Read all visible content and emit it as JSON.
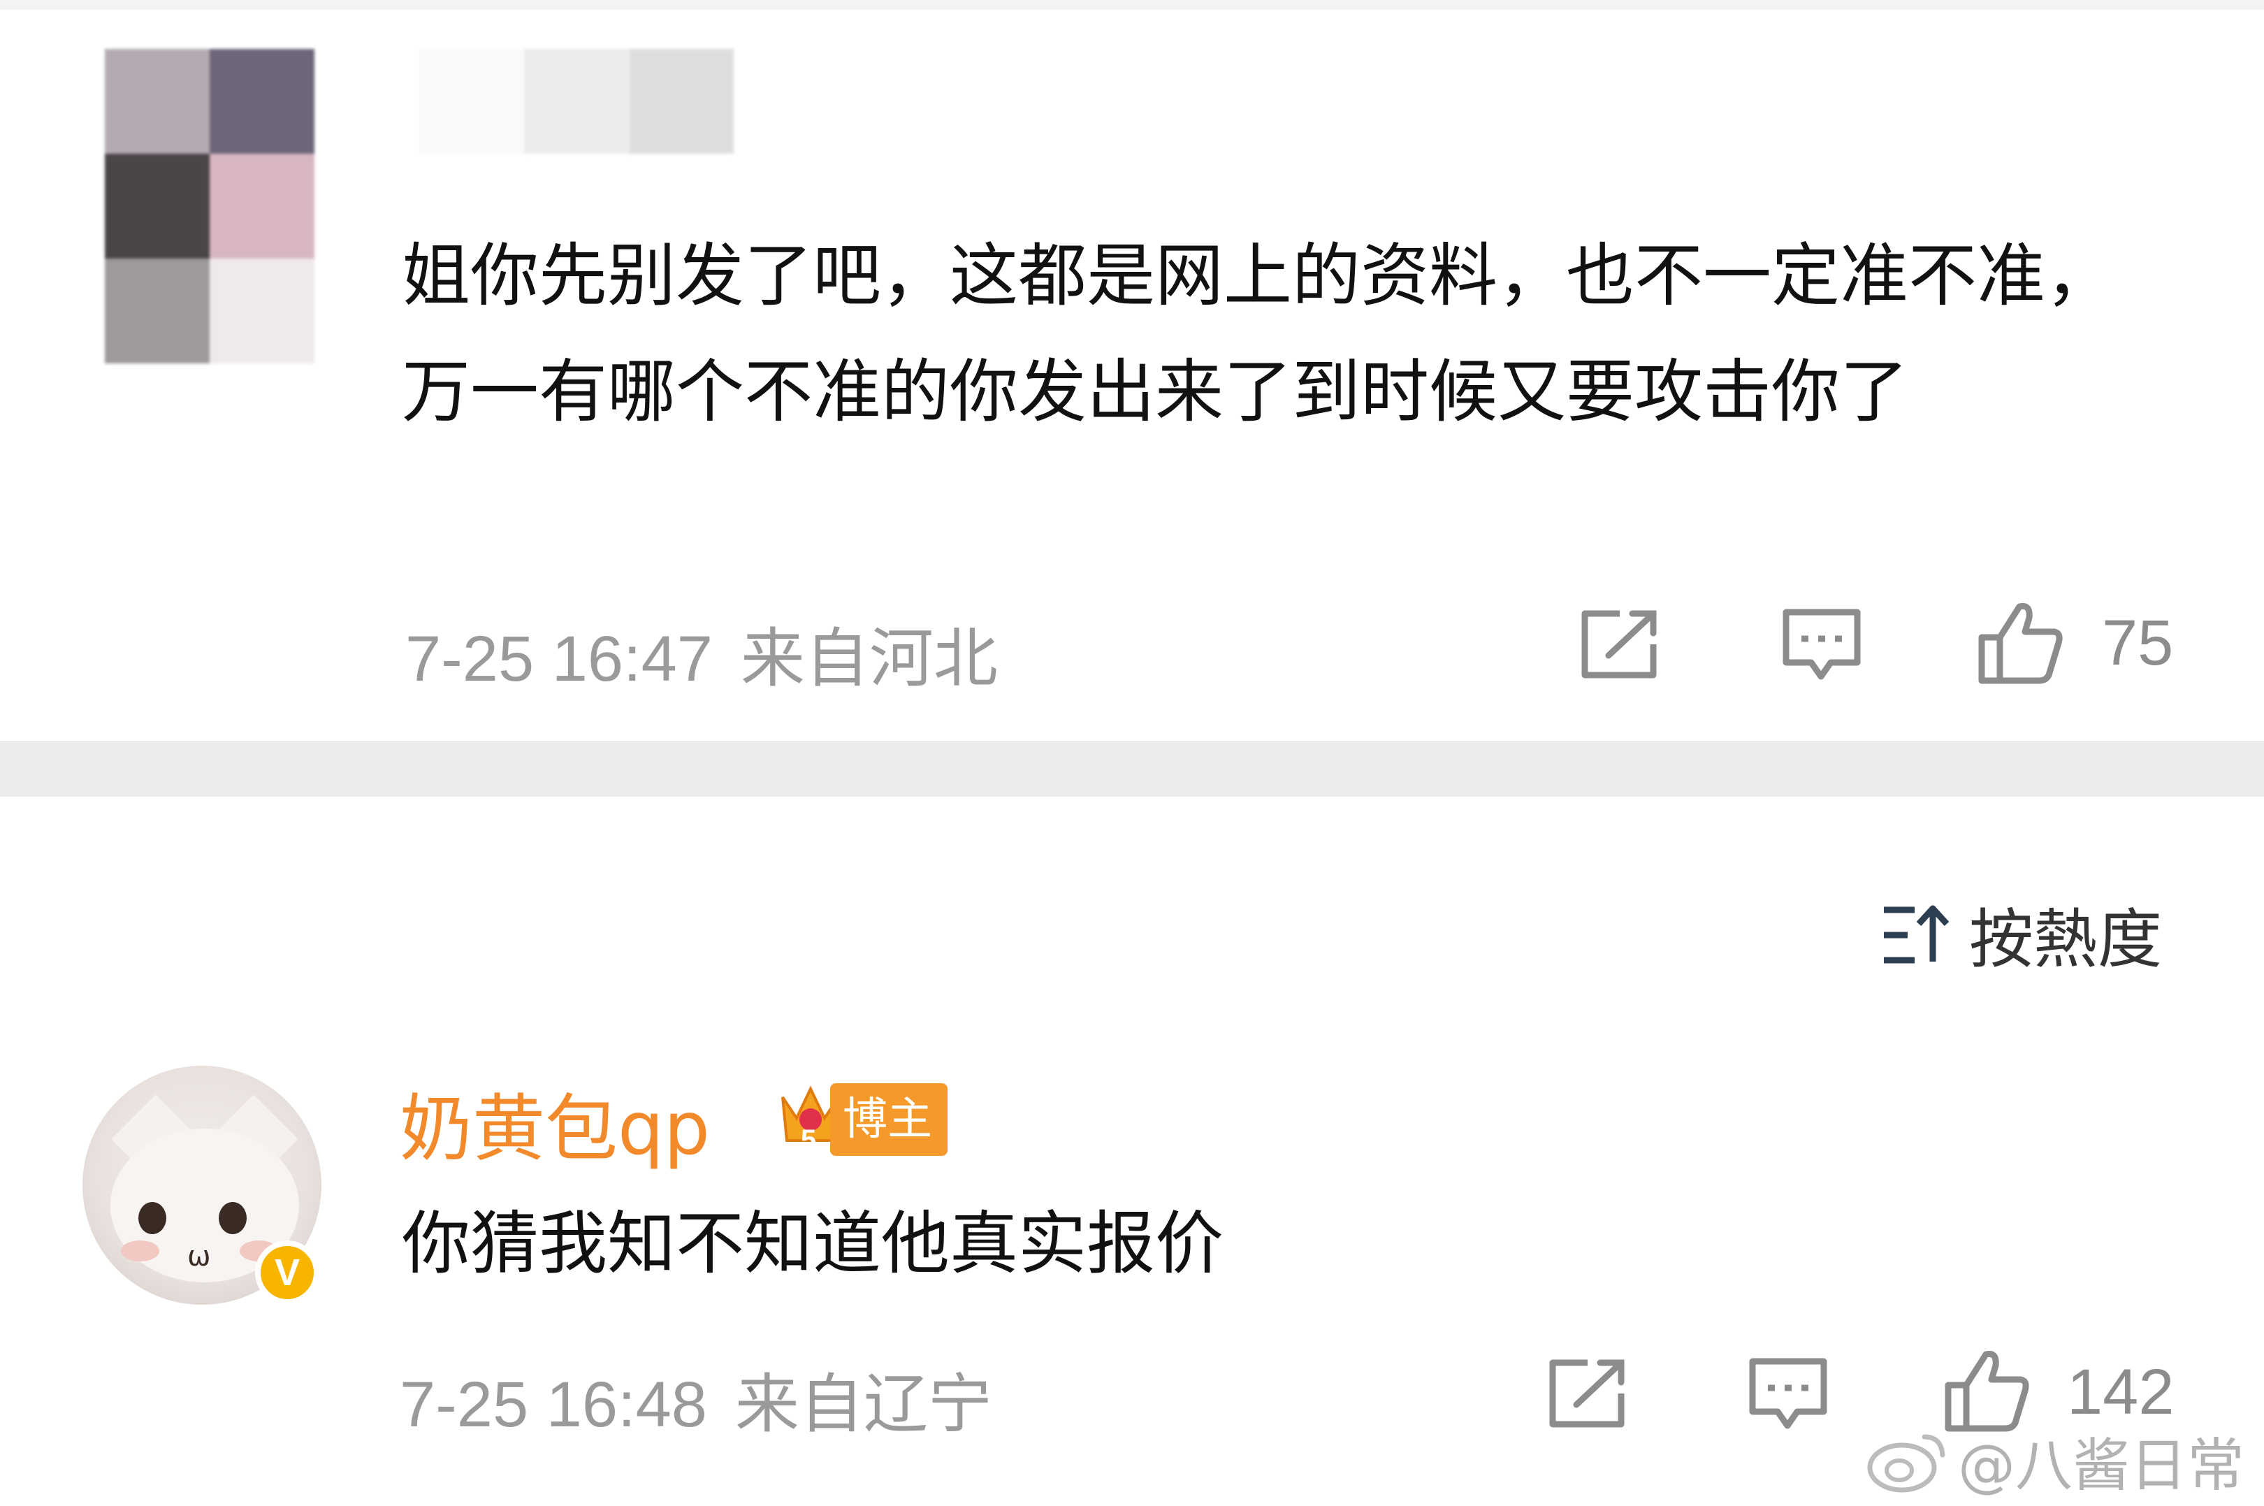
{
  "comment1": {
    "text": "姐你先别发了吧，这都是网上的资料，也不一定准不准，万一有哪个不准的你发出来了到时候又要攻击你了",
    "date": "7-25 16:47",
    "location": "来自河北",
    "like_count": "75",
    "icons": [
      "share-icon",
      "comment-icon",
      "like-icon"
    ]
  },
  "sort": {
    "label": "按熱度",
    "icon": "sort-icon"
  },
  "comment2": {
    "username": "奶黄包qp",
    "badge_label": "博主",
    "badge_level": "5",
    "verified_mark": "V",
    "text": "你猜我知不知道他真实报价",
    "date": "7-25 16:48",
    "location": "来自辽宁",
    "like_count": "142",
    "icons": [
      "share-icon",
      "comment-icon",
      "like-icon"
    ]
  },
  "watermark": {
    "text": "@八酱日常",
    "icon": "weibo-logo-icon"
  },
  "colors": {
    "username": "#f28a2c",
    "badge": "#f59a2a",
    "verified": "#f7b500",
    "meta_text": "#9a9a9a",
    "divider": "#ececec"
  }
}
